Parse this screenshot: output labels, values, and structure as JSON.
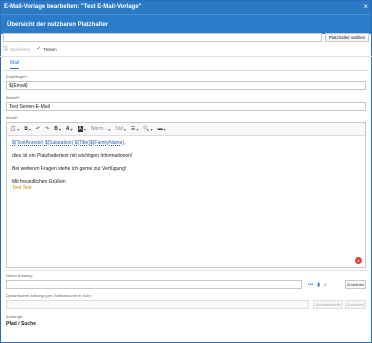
{
  "window": {
    "title": "E-Mail-Vorlage bearbeiten: \"Test E-Mail-Vorlage\"",
    "close_icon": "×"
  },
  "header": {
    "title": "Übersicht der nutzbaren Platzhalter"
  },
  "placeholder_bar": {
    "value": "",
    "button_label": "Platzhalter wählen"
  },
  "actions": {
    "save_label": "Speichern",
    "test_label": "Testen"
  },
  "tabs": [
    {
      "label": "Mail",
      "active": true
    }
  ],
  "recipient": {
    "label": "Empfänger*:",
    "value": "${Email}"
  },
  "subject": {
    "label": "Betreff*:",
    "value": "Test Serien-E-Mail"
  },
  "body": {
    "label": "Inhalt*:",
    "toolbar": {
      "style_label": "Norm...",
      "size_label": "Std"
    },
    "line1": [
      "${TextAnrede}",
      " ",
      "${Salutation}",
      " ",
      "${Title}",
      "${FamilyName}",
      ","
    ],
    "line2": "dies ist ein Platzhaltertext mit wichtigen Informationen!",
    "line3": "Bei weiteren Fragen stehe ich gerne zur Verfügung!",
    "line4": "Mit freundlichen Grüßen",
    "line5": "Test Test",
    "badge": "4"
  },
  "attachment": {
    "label": "Neuer Anhang:",
    "value": "",
    "assign_label": "Zuordnen"
  },
  "dynamic_attachment": {
    "label": "Dynamischer Anhang (per Volltextsuche in Solr):",
    "value": "",
    "search_label": "Suchabschnitt",
    "assign_label": "Zuordnen"
  },
  "attachments": {
    "label": "Anhänge:",
    "column": "Pfad / Suche"
  },
  "colors": {
    "accent": "#2b78c5",
    "badge": "#d9463a",
    "signature": "#c9830a"
  }
}
